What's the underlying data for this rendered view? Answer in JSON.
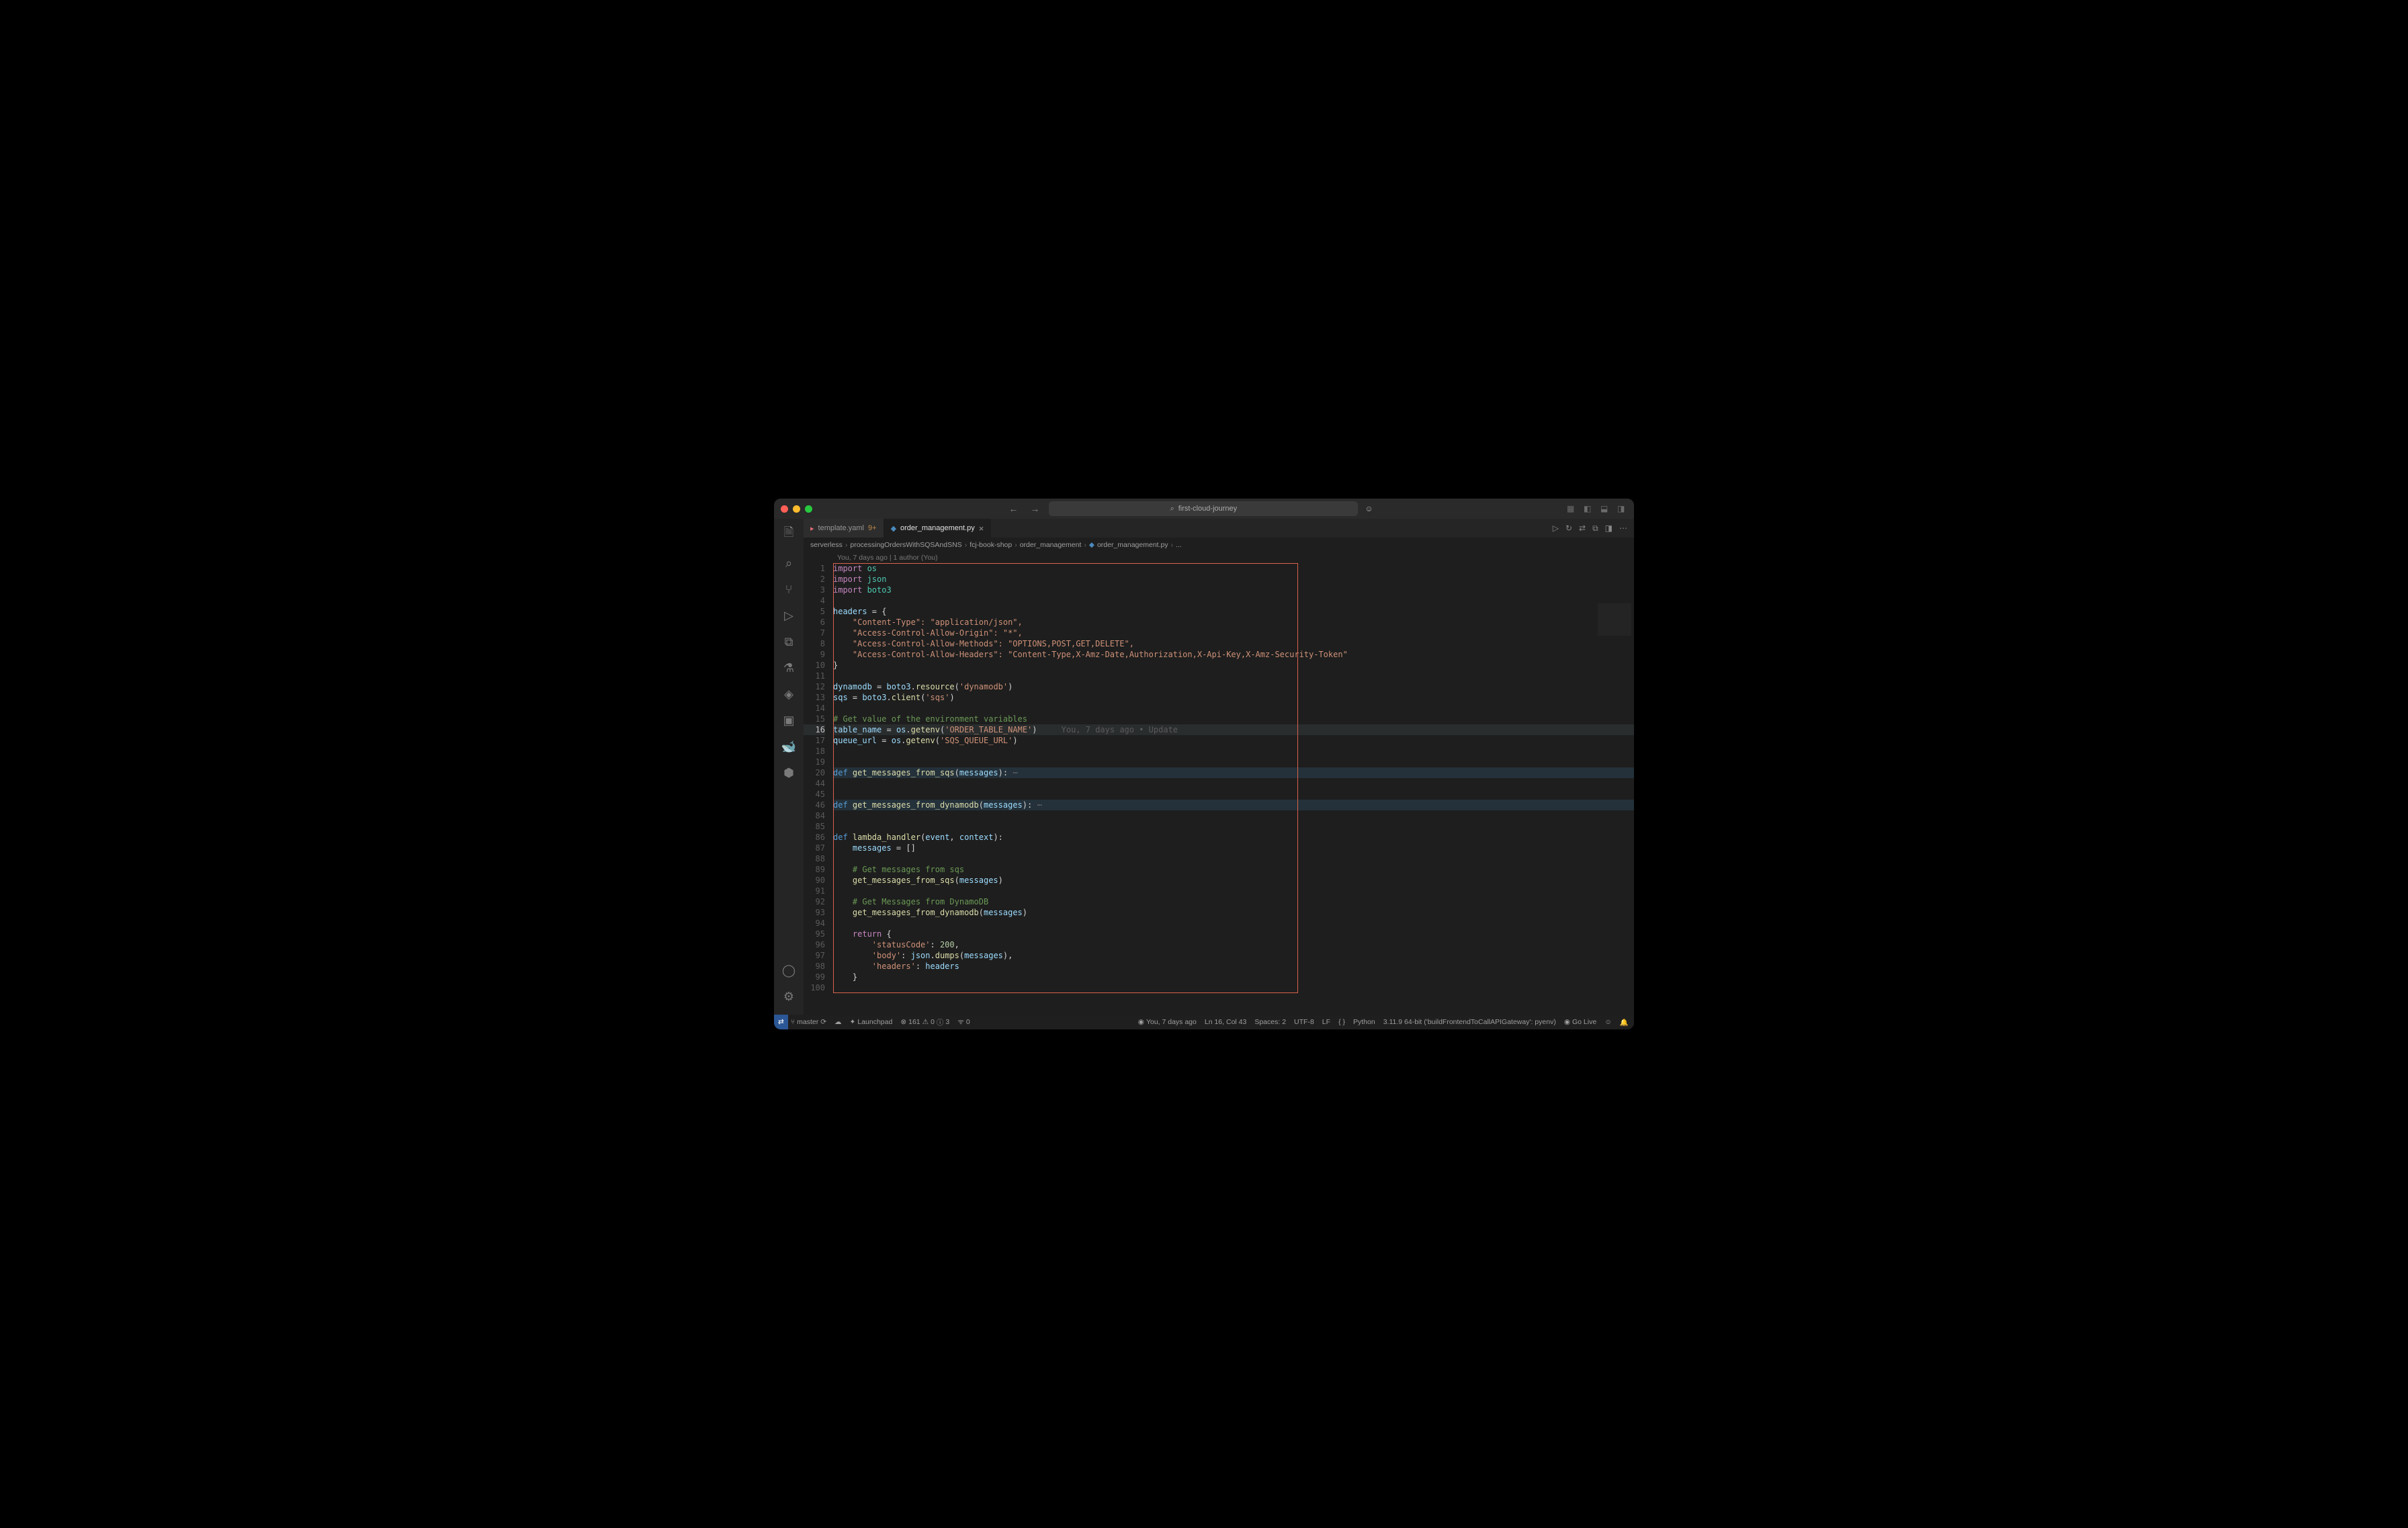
{
  "titlebar": {
    "search_placeholder": "first-cloud-journey"
  },
  "tabs": [
    {
      "label": "template.yaml",
      "suffix": "9+",
      "icon": "yaml",
      "active": false
    },
    {
      "label": "order_management.py",
      "icon": "py",
      "active": true
    }
  ],
  "breadcrumb": [
    "serverless",
    "processingOrdersWithSQSAndSNS",
    "fcj-book-shop",
    "order_management",
    "order_management.py",
    "..."
  ],
  "codelens": "You, 7 days ago | 1 author (You)",
  "inline_blame": "You, 7 days ago • Update",
  "gutter_lines": [
    "1",
    "2",
    "3",
    "4",
    "5",
    "6",
    "7",
    "8",
    "9",
    "10",
    "11",
    "12",
    "13",
    "14",
    "15",
    "16",
    "17",
    "18",
    "19",
    "20",
    "44",
    "45",
    "46",
    "84",
    "85",
    "86",
    "87",
    "88",
    "89",
    "90",
    "91",
    "92",
    "93",
    "94",
    "95",
    "96",
    "97",
    "98",
    "99",
    "100"
  ],
  "code": {
    "l1a": "import ",
    "l1b": "os",
    "l2a": "import ",
    "l2b": "json",
    "l3a": "import ",
    "l3b": "boto3",
    "l5": "headers = {",
    "l6": "    \"Content-Type\": \"application/json\",",
    "l7": "    \"Access-Control-Allow-Origin\": \"*\",",
    "l8": "    \"Access-Control-Allow-Methods\": \"OPTIONS,POST,GET,DELETE\",",
    "l9": "    \"Access-Control-Allow-Headers\": \"Content-Type,X-Amz-Date,Authorization,X-Api-Key,X-Amz-Security-Token\"",
    "l10": "}",
    "l12": "dynamodb = boto3.resource('dynamodb')",
    "l13": "sqs = boto3.client('sqs')",
    "l15": "# Get value of the environment variables",
    "l16": "table_name = os.getenv('ORDER_TABLE_NAME')",
    "l17": "queue_url = os.getenv('SQS_QUEUE_URL')",
    "l20a": "def ",
    "l20b": "get_messages_from_sqs",
    "l20c": "(messages):",
    "l46a": "def ",
    "l46b": "get_messages_from_dynamodb",
    "l46c": "(messages):",
    "l86a": "def ",
    "l86b": "lambda_handler",
    "l86c": "(event, context):",
    "l87": "    messages = []",
    "l89": "    # Get messages from sqs",
    "l90": "    get_messages_from_sqs(messages)",
    "l92": "    # Get Messages from DynamoDB",
    "l93": "    get_messages_from_dynamodb(messages)",
    "l95": "    return {",
    "l96": "        'statusCode': 200,",
    "l97": "        'body': json.dumps(messages),",
    "l98": "        'headers': headers",
    "l99": "    }"
  },
  "statusbar": {
    "branch": "master",
    "launchpad": "Launchpad",
    "problems_161": "161",
    "problems_warn": "0",
    "problems_3": "3",
    "ports": "0",
    "blame": "You, 7 days ago",
    "position": "Ln 16, Col 43",
    "spaces": "Spaces: 2",
    "encoding": "UTF-8",
    "eol": "LF",
    "braces": "{ }",
    "language": "Python",
    "interpreter": "3.11.9 64-bit ('buildFrontendToCallAPIGateway': pyenv)",
    "golive": "Go Live"
  }
}
